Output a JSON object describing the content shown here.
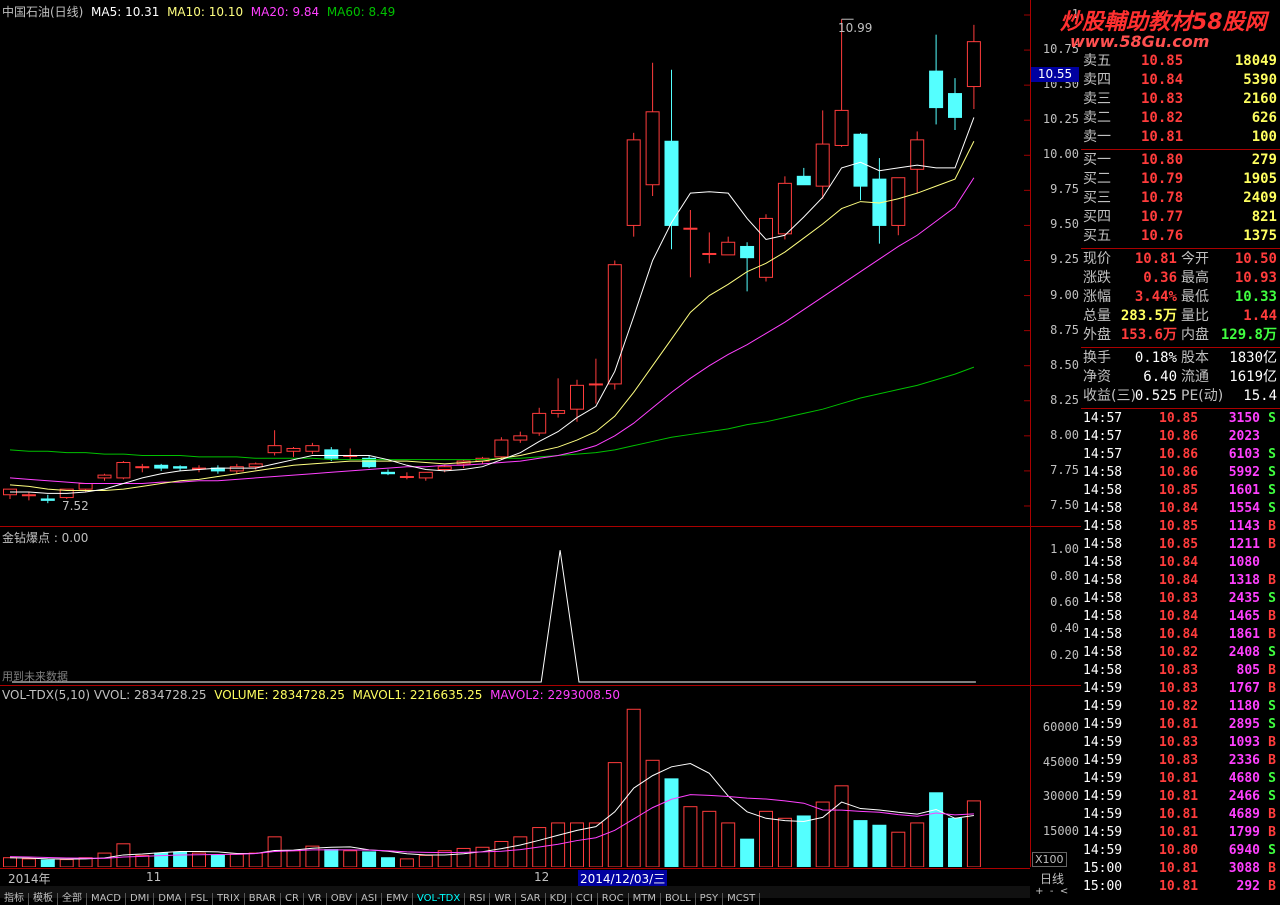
{
  "main_title": {
    "name": "中国石油(日线)",
    "ma5": "MA5: 10.31",
    "ma10": "MA10: 10.10",
    "ma20": "MA20: 9.84",
    "ma60": "MA60: 8.49"
  },
  "colors": {
    "up": "#ff3c3c",
    "down": "#54ffff",
    "ma5": "#ffffff",
    "ma10": "#ffff80",
    "ma20": "#ff40ff",
    "ma60": "#00c000",
    "grid": "#a00000"
  },
  "price_axis": [
    "1",
    "10.75",
    "10.50",
    "10.25",
    "10.00",
    "9.75",
    "9.50",
    "9.25",
    "9.00",
    "8.75",
    "8.50",
    "8.25",
    "8.00",
    "7.75",
    "7.50"
  ],
  "current_price_tag": "10.55",
  "high_annotation": "10.99",
  "low_annotation": "7.52",
  "indicator": {
    "title": "金钻爆点 : 0.00",
    "note": "用到未来数据",
    "axis": [
      "1.00",
      "0.80",
      "0.60",
      "0.40",
      "0.20"
    ]
  },
  "volume": {
    "title_prefix": "VOL-TDX(5,10)  VVOL: 2834728.25",
    "volume": "VOLUME: 2834728.25",
    "mavol1": "MAVOL1: 2216635.25",
    "mavol2": "MAVOL2: 2293008.50",
    "axis": [
      "60000",
      "45000",
      "30000",
      "15000"
    ],
    "unit": "X100"
  },
  "time_axis": {
    "year": "2014年",
    "m11": "11",
    "m12": "12",
    "cursor_date": "2014/12/03/三",
    "period": "日线"
  },
  "tabs": [
    "指标",
    "模板",
    "全部",
    "MACD",
    "DMI",
    "DMA",
    "FSL",
    "TRIX",
    "BRAR",
    "CR",
    "VR",
    "OBV",
    "ASI",
    "EMV",
    "VOL-TDX",
    "RSI",
    "WR",
    "SAR",
    "KDJ",
    "CCI",
    "ROC",
    "MTM",
    "BOLL",
    "PSY",
    "MCST"
  ],
  "quote": {
    "sell": [
      {
        "label": "卖五",
        "price": "10.85",
        "vol": "18049"
      },
      {
        "label": "卖四",
        "price": "10.84",
        "vol": "5390"
      },
      {
        "label": "卖三",
        "price": "10.83",
        "vol": "2160"
      },
      {
        "label": "卖二",
        "price": "10.82",
        "vol": "626"
      },
      {
        "label": "卖一",
        "price": "10.81",
        "vol": "100"
      }
    ],
    "buy": [
      {
        "label": "买一",
        "price": "10.80",
        "vol": "279"
      },
      {
        "label": "买二",
        "price": "10.79",
        "vol": "1905"
      },
      {
        "label": "买三",
        "price": "10.78",
        "vol": "2409"
      },
      {
        "label": "买四",
        "price": "10.77",
        "vol": "821"
      },
      {
        "label": "买五",
        "price": "10.76",
        "vol": "1375"
      }
    ],
    "stats1": [
      {
        "l1": "现价",
        "v1": "10.81",
        "c1": "#ff3c3c",
        "l2": "今开",
        "v2": "10.50",
        "c2": "#ff3c3c"
      },
      {
        "l1": "涨跌",
        "v1": "0.36",
        "c1": "#ff3c3c",
        "l2": "最高",
        "v2": "10.93",
        "c2": "#ff3c3c"
      },
      {
        "l1": "涨幅",
        "v1": "3.44%",
        "c1": "#ff3c3c",
        "l2": "最低",
        "v2": "10.33",
        "c2": "#40ff40"
      },
      {
        "l1": "总量",
        "v1": "283.5万",
        "c1": "#ffff60",
        "l2": "量比",
        "v2": "1.44",
        "c2": "#ff3c3c"
      },
      {
        "l1": "外盘",
        "v1": "153.6万",
        "c1": "#ff3c3c",
        "l2": "内盘",
        "v2": "129.8万",
        "c2": "#40ff40"
      }
    ],
    "stats2": [
      {
        "l1": "换手",
        "v1": "0.18%",
        "l2": "股本",
        "v2": "1830亿"
      },
      {
        "l1": "净资",
        "v1": "6.40",
        "l2": "流通",
        "v2": "1619亿"
      },
      {
        "l1": "收益(三)",
        "v1": "0.525",
        "l2": "PE(动)",
        "v2": "15.4"
      }
    ],
    "ticks": [
      {
        "t": "14:57",
        "p": "10.85",
        "v": "3150",
        "d": "S"
      },
      {
        "t": "14:57",
        "p": "10.86",
        "v": "2023",
        "d": ""
      },
      {
        "t": "14:57",
        "p": "10.86",
        "v": "6103",
        "d": "S"
      },
      {
        "t": "14:58",
        "p": "10.86",
        "v": "5992",
        "d": "S"
      },
      {
        "t": "14:58",
        "p": "10.85",
        "v": "1601",
        "d": "S"
      },
      {
        "t": "14:58",
        "p": "10.84",
        "v": "1554",
        "d": "S"
      },
      {
        "t": "14:58",
        "p": "10.85",
        "v": "1143",
        "d": "B"
      },
      {
        "t": "14:58",
        "p": "10.85",
        "v": "1211",
        "d": "B"
      },
      {
        "t": "14:58",
        "p": "10.84",
        "v": "1080",
        "d": ""
      },
      {
        "t": "14:58",
        "p": "10.84",
        "v": "1318",
        "d": "B"
      },
      {
        "t": "14:58",
        "p": "10.83",
        "v": "2435",
        "d": "S"
      },
      {
        "t": "14:58",
        "p": "10.84",
        "v": "1465",
        "d": "B"
      },
      {
        "t": "14:58",
        "p": "10.84",
        "v": "1861",
        "d": "B"
      },
      {
        "t": "14:58",
        "p": "10.82",
        "v": "2408",
        "d": "S"
      },
      {
        "t": "14:58",
        "p": "10.83",
        "v": "805",
        "d": "B"
      },
      {
        "t": "14:59",
        "p": "10.83",
        "v": "1767",
        "d": "B"
      },
      {
        "t": "14:59",
        "p": "10.82",
        "v": "1180",
        "d": "S"
      },
      {
        "t": "14:59",
        "p": "10.81",
        "v": "2895",
        "d": "S"
      },
      {
        "t": "14:59",
        "p": "10.83",
        "v": "1093",
        "d": "B"
      },
      {
        "t": "14:59",
        "p": "10.83",
        "v": "2336",
        "d": "B"
      },
      {
        "t": "14:59",
        "p": "10.81",
        "v": "4680",
        "d": "S"
      },
      {
        "t": "14:59",
        "p": "10.81",
        "v": "2466",
        "d": "S"
      },
      {
        "t": "14:59",
        "p": "10.81",
        "v": "4689",
        "d": "B"
      },
      {
        "t": "14:59",
        "p": "10.81",
        "v": "1799",
        "d": "B"
      },
      {
        "t": "14:59",
        "p": "10.80",
        "v": "6940",
        "d": "S"
      },
      {
        "t": "15:00",
        "p": "10.81",
        "v": "3088",
        "d": "B"
      },
      {
        "t": "15:00",
        "p": "10.81",
        "v": "292",
        "d": "B"
      }
    ]
  },
  "watermark": {
    "line1": "炒股輔助教材58股网",
    "line2": "www.58Gu.com"
  },
  "chart_data": {
    "type": "candlestick",
    "candles": [
      {
        "o": 7.58,
        "h": 7.62,
        "l": 7.55,
        "c": 7.62
      },
      {
        "o": 7.58,
        "h": 7.6,
        "l": 7.54,
        "c": 7.58
      },
      {
        "o": 7.55,
        "h": 7.58,
        "l": 7.52,
        "c": 7.54
      },
      {
        "o": 7.56,
        "h": 7.62,
        "l": 7.55,
        "c": 7.62
      },
      {
        "o": 7.62,
        "h": 7.66,
        "l": 7.6,
        "c": 7.66
      },
      {
        "o": 7.7,
        "h": 7.73,
        "l": 7.68,
        "c": 7.72
      },
      {
        "o": 7.7,
        "h": 7.82,
        "l": 7.69,
        "c": 7.81
      },
      {
        "o": 7.78,
        "h": 7.8,
        "l": 7.74,
        "c": 7.78
      },
      {
        "o": 7.79,
        "h": 7.8,
        "l": 7.75,
        "c": 7.77
      },
      {
        "o": 7.78,
        "h": 7.79,
        "l": 7.75,
        "c": 7.77
      },
      {
        "o": 7.77,
        "h": 7.79,
        "l": 7.74,
        "c": 7.77
      },
      {
        "o": 7.77,
        "h": 7.79,
        "l": 7.73,
        "c": 7.75
      },
      {
        "o": 7.75,
        "h": 7.8,
        "l": 7.73,
        "c": 7.78
      },
      {
        "o": 7.78,
        "h": 7.81,
        "l": 7.76,
        "c": 7.8
      },
      {
        "o": 7.88,
        "h": 8.04,
        "l": 7.86,
        "c": 7.93
      },
      {
        "o": 7.89,
        "h": 7.92,
        "l": 7.85,
        "c": 7.91
      },
      {
        "o": 7.89,
        "h": 7.95,
        "l": 7.87,
        "c": 7.93
      },
      {
        "o": 7.9,
        "h": 7.92,
        "l": 7.82,
        "c": 7.84
      },
      {
        "o": 7.86,
        "h": 7.91,
        "l": 7.83,
        "c": 7.86
      },
      {
        "o": 7.84,
        "h": 7.86,
        "l": 7.77,
        "c": 7.78
      },
      {
        "o": 7.74,
        "h": 7.76,
        "l": 7.72,
        "c": 7.73
      },
      {
        "o": 7.71,
        "h": 7.74,
        "l": 7.69,
        "c": 7.71
      },
      {
        "o": 7.7,
        "h": 7.73,
        "l": 7.68,
        "c": 7.74
      },
      {
        "o": 7.76,
        "h": 7.79,
        "l": 7.74,
        "c": 7.78
      },
      {
        "o": 7.8,
        "h": 7.83,
        "l": 7.77,
        "c": 7.82
      },
      {
        "o": 7.82,
        "h": 7.85,
        "l": 7.8,
        "c": 7.84
      },
      {
        "o": 7.85,
        "h": 7.99,
        "l": 7.83,
        "c": 7.97
      },
      {
        "o": 7.97,
        "h": 8.03,
        "l": 7.95,
        "c": 8.0
      },
      {
        "o": 8.02,
        "h": 8.2,
        "l": 8.0,
        "c": 8.16
      },
      {
        "o": 8.16,
        "h": 8.41,
        "l": 8.13,
        "c": 8.18
      },
      {
        "o": 8.19,
        "h": 8.4,
        "l": 8.1,
        "c": 8.36
      },
      {
        "o": 8.37,
        "h": 8.55,
        "l": 8.23,
        "c": 8.37
      },
      {
        "o": 8.37,
        "h": 9.25,
        "l": 8.33,
        "c": 9.22
      },
      {
        "o": 9.5,
        "h": 10.16,
        "l": 9.42,
        "c": 10.11
      },
      {
        "o": 9.79,
        "h": 10.66,
        "l": 9.71,
        "c": 10.31
      },
      {
        "o": 10.1,
        "h": 10.61,
        "l": 9.33,
        "c": 9.5
      },
      {
        "o": 9.48,
        "h": 9.61,
        "l": 9.13,
        "c": 9.48
      },
      {
        "o": 9.3,
        "h": 9.45,
        "l": 9.23,
        "c": 9.3
      },
      {
        "o": 9.29,
        "h": 9.42,
        "l": 9.3,
        "c": 9.38
      },
      {
        "o": 9.35,
        "h": 9.38,
        "l": 9.03,
        "c": 9.27
      },
      {
        "o": 9.13,
        "h": 9.58,
        "l": 9.1,
        "c": 9.55
      },
      {
        "o": 9.44,
        "h": 9.85,
        "l": 9.4,
        "c": 9.8
      },
      {
        "o": 9.85,
        "h": 9.91,
        "l": 9.81,
        "c": 9.79
      },
      {
        "o": 9.78,
        "h": 10.32,
        "l": 9.69,
        "c": 10.08
      },
      {
        "o": 10.07,
        "h": 10.97,
        "l": 10.06,
        "c": 10.32
      },
      {
        "o": 10.15,
        "h": 10.16,
        "l": 9.68,
        "c": 9.78
      },
      {
        "o": 9.83,
        "h": 9.98,
        "l": 9.37,
        "c": 9.5
      },
      {
        "o": 9.5,
        "h": 9.84,
        "l": 9.43,
        "c": 9.84
      },
      {
        "o": 9.9,
        "h": 10.17,
        "l": 9.73,
        "c": 10.11
      },
      {
        "o": 10.6,
        "h": 10.86,
        "l": 10.22,
        "c": 10.34
      },
      {
        "o": 10.44,
        "h": 10.55,
        "l": 10.18,
        "c": 10.27
      },
      {
        "o": 10.49,
        "h": 10.93,
        "l": 10.33,
        "c": 10.81
      }
    ],
    "ma5": [
      7.6,
      7.6,
      7.59,
      7.59,
      7.6,
      7.62,
      7.66,
      7.7,
      7.73,
      7.75,
      7.76,
      7.77,
      7.77,
      7.77,
      7.8,
      7.83,
      7.86,
      7.86,
      7.86,
      7.86,
      7.83,
      7.79,
      7.76,
      7.75,
      7.76,
      7.78,
      7.83,
      7.88,
      7.96,
      8.03,
      8.13,
      8.21,
      8.46,
      8.85,
      9.25,
      9.52,
      9.73,
      9.74,
      9.73,
      9.55,
      9.4,
      9.43,
      9.56,
      9.7,
      9.91,
      9.95,
      9.89,
      9.91,
      9.93,
      9.91,
      9.91,
      10.27
    ],
    "ma10": [
      7.65,
      7.64,
      7.62,
      7.61,
      7.61,
      7.61,
      7.62,
      7.64,
      7.66,
      7.68,
      7.69,
      7.71,
      7.73,
      7.75,
      7.77,
      7.79,
      7.8,
      7.81,
      7.82,
      7.82,
      7.82,
      7.82,
      7.81,
      7.8,
      7.81,
      7.82,
      7.84,
      7.86,
      7.89,
      7.92,
      7.97,
      8.03,
      8.14,
      8.31,
      8.5,
      8.69,
      8.88,
      9.0,
      9.08,
      9.17,
      9.23,
      9.31,
      9.41,
      9.51,
      9.62,
      9.67,
      9.66,
      9.69,
      9.73,
      9.78,
      9.83,
      10.1
    ],
    "ma20": [
      7.7,
      7.69,
      7.68,
      7.67,
      7.66,
      7.66,
      7.66,
      7.66,
      7.67,
      7.67,
      7.68,
      7.68,
      7.69,
      7.7,
      7.71,
      7.72,
      7.73,
      7.74,
      7.75,
      7.76,
      7.77,
      7.78,
      7.78,
      7.79,
      7.79,
      7.8,
      7.81,
      7.82,
      7.84,
      7.86,
      7.89,
      7.93,
      8.0,
      8.09,
      8.2,
      8.31,
      8.41,
      8.5,
      8.58,
      8.65,
      8.73,
      8.81,
      8.9,
      8.99,
      9.08,
      9.17,
      9.26,
      9.35,
      9.43,
      9.53,
      9.63,
      9.84
    ],
    "ma60": [
      7.9,
      7.89,
      7.89,
      7.88,
      7.88,
      7.87,
      7.87,
      7.86,
      7.86,
      7.86,
      7.85,
      7.85,
      7.85,
      7.84,
      7.84,
      7.84,
      7.84,
      7.83,
      7.83,
      7.83,
      7.83,
      7.83,
      7.83,
      7.83,
      7.83,
      7.83,
      7.84,
      7.84,
      7.85,
      7.86,
      7.87,
      7.88,
      7.9,
      7.93,
      7.96,
      7.99,
      8.01,
      8.03,
      8.05,
      8.08,
      8.1,
      8.13,
      8.16,
      8.19,
      8.23,
      8.27,
      8.3,
      8.33,
      8.36,
      8.4,
      8.44,
      8.49
    ],
    "price_range": [
      7.4,
      11.05
    ],
    "indicator_values": [
      0,
      0,
      0,
      0,
      0,
      0,
      0,
      0,
      0,
      0,
      0,
      0,
      0,
      0,
      0,
      0,
      0,
      0,
      0,
      0,
      0,
      0,
      0,
      0,
      0,
      0,
      0,
      0,
      0,
      1,
      0,
      0,
      0,
      0,
      0,
      0,
      0,
      0,
      0,
      0,
      0,
      0,
      0,
      0,
      0,
      0,
      0,
      0,
      0,
      0,
      0,
      0
    ],
    "indicator_range": [
      0,
      1.1
    ],
    "volumes": [
      4000,
      3500,
      3000,
      3200,
      4000,
      6000,
      10000,
      5000,
      6000,
      6500,
      6000,
      5000,
      5500,
      6000,
      13000,
      7000,
      9000,
      7500,
      7000,
      6500,
      4000,
      3500,
      5000,
      7000,
      8000,
      8500,
      11000,
      13000,
      17000,
      19000,
      19000,
      19000,
      45000,
      68000,
      46000,
      38000,
      26000,
      24000,
      19000,
      12000,
      24000,
      21000,
      22000,
      28000,
      35000,
      20000,
      18000,
      15000,
      19000,
      32000,
      21000,
      28500
    ],
    "mavol1": [
      4000,
      3800,
      3500,
      3400,
      3500,
      3900,
      5200,
      5600,
      6200,
      6700,
      6700,
      6500,
      5800,
      5800,
      7100,
      7300,
      8100,
      8500,
      8700,
      7400,
      6800,
      5700,
      5200,
      5200,
      5700,
      6600,
      7900,
      9500,
      11500,
      13700,
      15800,
      17400,
      23800,
      34000,
      39400,
      43200,
      44600,
      40400,
      30600,
      23800,
      21000,
      20000,
      19600,
      21400,
      28000,
      25200,
      24600,
      23600,
      22800,
      24800,
      21000,
      22200
    ],
    "mavol2": [
      4500,
      4300,
      4100,
      3900,
      3800,
      3700,
      4300,
      4600,
      4900,
      5200,
      5300,
      5400,
      5500,
      5800,
      6700,
      7000,
      7400,
      7400,
      7400,
      7300,
      7000,
      6500,
      6300,
      6200,
      6300,
      6500,
      6800,
      7500,
      8600,
      9800,
      11400,
      12600,
      15800,
      20700,
      25600,
      29200,
      31200,
      30900,
      30400,
      29700,
      29300,
      28500,
      27500,
      24600,
      24500,
      24000,
      23600,
      22600,
      21900,
      23300,
      22500,
      22900
    ],
    "volume_range": [
      0,
      72000
    ]
  }
}
